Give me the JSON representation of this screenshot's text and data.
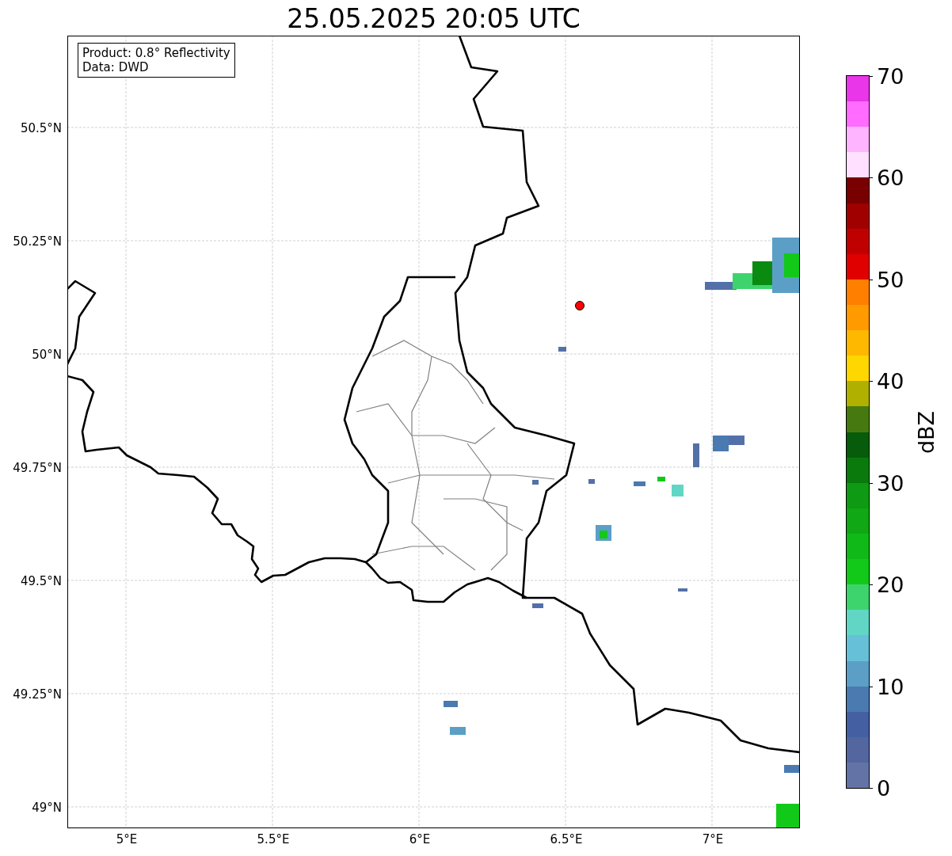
{
  "title": "25.05.2025 20:05 UTC",
  "info_box": {
    "lines": [
      "Product: 0.8° Reflectivity",
      "Data: DWD"
    ]
  },
  "map": {
    "longitude_labels": [
      "5°E",
      "5.5°E",
      "6°E",
      "6.5°E",
      "7°E"
    ],
    "latitude_labels": [
      "50.5°N",
      "50.25°N",
      "50°N",
      "49.75°N",
      "49.5°N",
      "49.25°N",
      "49°N"
    ]
  },
  "colorbar": {
    "label": "dBZ",
    "ticks": [
      "70",
      "60",
      "50",
      "40",
      "30",
      "20",
      "10",
      "0"
    ],
    "bands": [
      {
        "color": "#e836e8"
      },
      {
        "color": "#ff6cff"
      },
      {
        "color": "#ffb4ff"
      },
      {
        "color": "#ffe0ff"
      },
      {
        "color": "#780000"
      },
      {
        "color": "#a00000"
      },
      {
        "color": "#c00000"
      },
      {
        "color": "#e00000"
      },
      {
        "color": "#ff7f00"
      },
      {
        "color": "#ff9a00"
      },
      {
        "color": "#ffb800"
      },
      {
        "color": "#ffd700"
      },
      {
        "color": "#b0b000"
      },
      {
        "color": "#467a10"
      },
      {
        "color": "#065c0a"
      },
      {
        "color": "#0a7a0c"
      },
      {
        "color": "#0e9a12"
      },
      {
        "color": "#10a814"
      },
      {
        "color": "#10b918"
      },
      {
        "color": "#12c91a"
      },
      {
        "color": "#3dd46e"
      },
      {
        "color": "#62d6c4"
      },
      {
        "color": "#66c0d8"
      },
      {
        "color": "#5b9fc6"
      },
      {
        "color": "#4a7ab0"
      },
      {
        "color": "#4460a3"
      },
      {
        "color": "#5466a0"
      },
      {
        "color": "#6473a6"
      }
    ]
  }
}
